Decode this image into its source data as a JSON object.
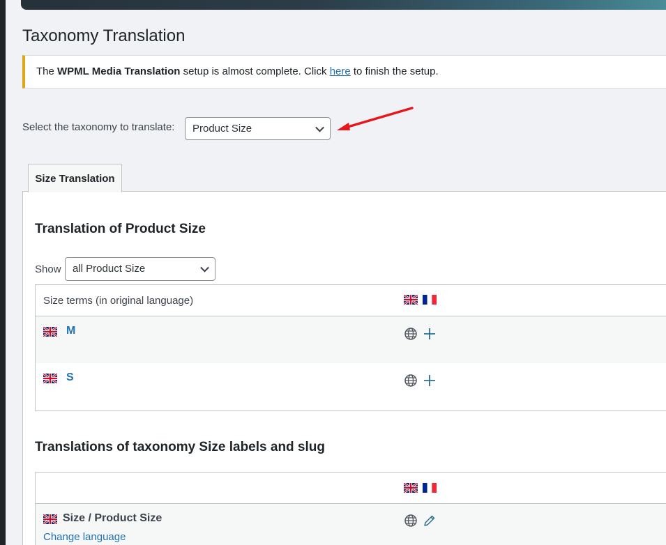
{
  "page": {
    "title": "Taxonomy Translation"
  },
  "notice": {
    "prefix": "The ",
    "bold": "WPML Media Translation",
    "middle": " setup is almost complete. Click ",
    "link": "here",
    "suffix": " to finish the setup."
  },
  "taxonomy_select": {
    "label": "Select the taxonomy to translate:",
    "value": "Product Size"
  },
  "tabs": [
    {
      "label": "Size Translation"
    }
  ],
  "terms_section": {
    "title": "Translation of Product Size",
    "show_label": "Show",
    "show_value": "all Product Size",
    "column_header": "Size terms (in original language)",
    "rows": [
      {
        "term": "M"
      },
      {
        "term": "S"
      }
    ]
  },
  "labels_section": {
    "title": "Translations of taxonomy Size labels and slug",
    "row_label": "Size / Product Size",
    "change_language": "Change language"
  },
  "colors": {
    "link": "#2271b1",
    "notice_border": "#dba617",
    "arrow": "#e8161b"
  },
  "icons": {
    "language_flags": [
      "flag-uk-icon",
      "flag-fr-icon"
    ],
    "row_actions": [
      "globe-icon",
      "plus-icon",
      "pencil-icon"
    ]
  }
}
